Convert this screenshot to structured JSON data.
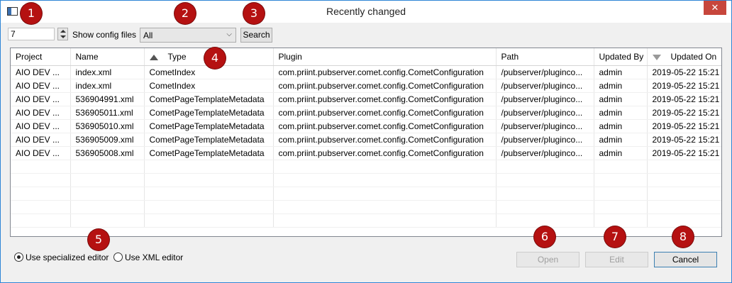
{
  "window": {
    "title": "Recently changed",
    "close_glyph": "✕"
  },
  "toolbar": {
    "days_value": "7",
    "show_config_label": "Show config files",
    "filter_selected": "All",
    "search_label": "Search"
  },
  "table": {
    "columns": [
      "Project",
      "Name",
      "Type",
      "Plugin",
      "Path",
      "Updated By",
      "Updated On"
    ],
    "rows": [
      [
        "AIO DEV ...",
        "index.xml",
        "CometIndex",
        "com.priint.pubserver.comet.config.CometConfiguration",
        "/pubserver/pluginco...",
        "admin",
        "2019-05-22 15:21"
      ],
      [
        "AIO DEV ...",
        "index.xml",
        "CometIndex",
        "com.priint.pubserver.comet.config.CometConfiguration",
        "/pubserver/pluginco...",
        "admin",
        "2019-05-22 15:21"
      ],
      [
        "AIO DEV ...",
        "536904991.xml",
        "CometPageTemplateMetadata",
        "com.priint.pubserver.comet.config.CometConfiguration",
        "/pubserver/pluginco...",
        "admin",
        "2019-05-22 15:21"
      ],
      [
        "AIO DEV ...",
        "536905011.xml",
        "CometPageTemplateMetadata",
        "com.priint.pubserver.comet.config.CometConfiguration",
        "/pubserver/pluginco...",
        "admin",
        "2019-05-22 15:21"
      ],
      [
        "AIO DEV ...",
        "536905010.xml",
        "CometPageTemplateMetadata",
        "com.priint.pubserver.comet.config.CometConfiguration",
        "/pubserver/pluginco...",
        "admin",
        "2019-05-22 15:21"
      ],
      [
        "AIO DEV ...",
        "536905009.xml",
        "CometPageTemplateMetadata",
        "com.priint.pubserver.comet.config.CometConfiguration",
        "/pubserver/pluginco...",
        "admin",
        "2019-05-22 15:21"
      ],
      [
        "AIO DEV ...",
        "536905008.xml",
        "CometPageTemplateMetadata",
        "com.priint.pubserver.comet.config.CometConfiguration",
        "/pubserver/pluginco...",
        "admin",
        "2019-05-22 15:21"
      ]
    ]
  },
  "editor_options": {
    "specialized": "Use specialized editor",
    "xml": "Use XML editor",
    "selected": "specialized"
  },
  "buttons": {
    "open": "Open",
    "edit": "Edit",
    "cancel": "Cancel"
  },
  "callouts": [
    "1",
    "2",
    "3",
    "4",
    "5",
    "6",
    "7",
    "8"
  ],
  "colors": {
    "callout": "#b51111",
    "window_border": "#2f86d6",
    "close_button": "#c7463c"
  }
}
